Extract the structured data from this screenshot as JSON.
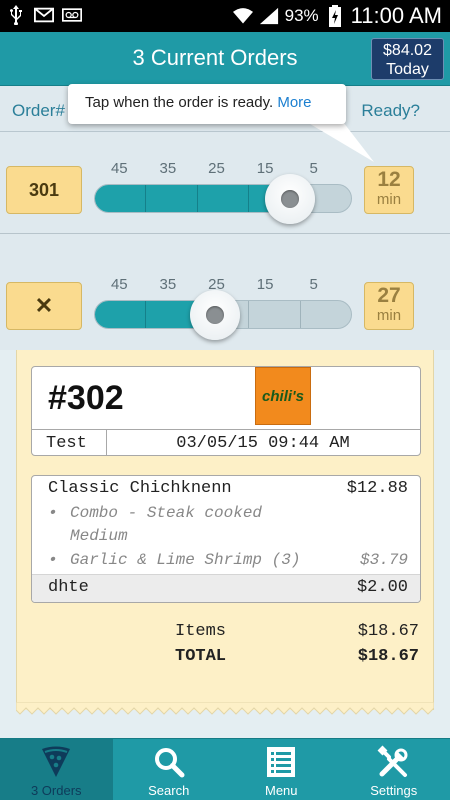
{
  "status_bar": {
    "battery_percent": "93%",
    "time": "11:00 AM",
    "icons": [
      "usb-icon",
      "email-icon",
      "voicemail-icon",
      "wifi-icon",
      "signal-icon",
      "battery-charging-icon"
    ]
  },
  "header": {
    "title": "3 Current Orders",
    "today_amount": "$84.02",
    "today_label": "Today"
  },
  "columns": {
    "order": "Order#",
    "ready": "Ready?"
  },
  "tooltip": {
    "text": "Tap when the order is ready.",
    "more": "More"
  },
  "orders": [
    {
      "badge": "301",
      "scale": [
        "45",
        "35",
        "25",
        "15",
        "5"
      ],
      "ready_time": "12",
      "ready_unit": "min",
      "progress": 0.76
    },
    {
      "badge": "✕",
      "scale": [
        "45",
        "35",
        "25",
        "15",
        "5"
      ],
      "ready_time": "27",
      "ready_unit": "min",
      "progress": 0.47
    }
  ],
  "ticket": {
    "number": "#302",
    "logo_text": "chili's",
    "customer": "Test",
    "datetime": "03/05/15 09:44 AM",
    "item_name": "Classic Chichknenn",
    "item_price": "$12.88",
    "mod1_line1": "Combo - Steak cooked",
    "mod1_line2": "Medium",
    "mod2": "Garlic & Lime Shrimp (3)",
    "mod2_price": "$3.79",
    "fee_name": "dhte",
    "fee_price": "$2.00",
    "items_label": "Items",
    "items_value": "$18.67",
    "total_label": "TOTAL",
    "total_value": "$18.67"
  },
  "nav": {
    "orders": "3 Orders",
    "search": "Search",
    "menu": "Menu",
    "settings": "Settings"
  },
  "colors": {
    "teal": "#1f9aa6",
    "navy": "#1d3c6a",
    "badge": "#fadb8f",
    "ticket": "#fdf0c7"
  }
}
